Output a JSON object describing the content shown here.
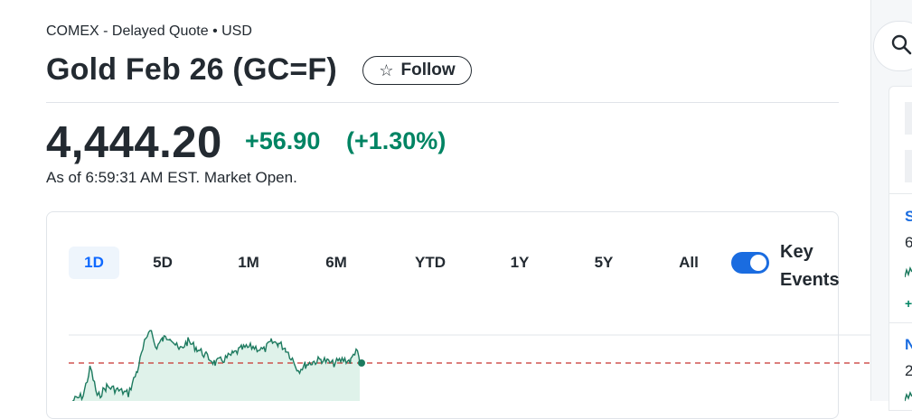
{
  "header": {
    "exchange": "COMEX - Delayed Quote • USD",
    "title": "Gold Feb 26 (GC=F)",
    "follow_label": "Follow",
    "follow_icon": "star-outline-icon"
  },
  "quote": {
    "price": "4,444.20",
    "change": "+56.90",
    "change_percent": "(+1.30%)",
    "as_of": "As of 6:59:31 AM EST. Market Open.",
    "positive_color": "#008463"
  },
  "chart": {
    "ranges": [
      "1D",
      "5D",
      "1M",
      "6M",
      "YTD",
      "1Y",
      "5Y",
      "All"
    ],
    "active_range": "1D",
    "key_events_label_line1": "Key",
    "key_events_label_line2": "Events",
    "key_events_on": true,
    "accent": "#1a6ce0"
  },
  "sidebar": {
    "search_icon": "search-icon",
    "item1": {
      "letter": "S",
      "value": "6",
      "change": "+"
    },
    "item2": {
      "letter": "N",
      "value": "2"
    }
  }
}
